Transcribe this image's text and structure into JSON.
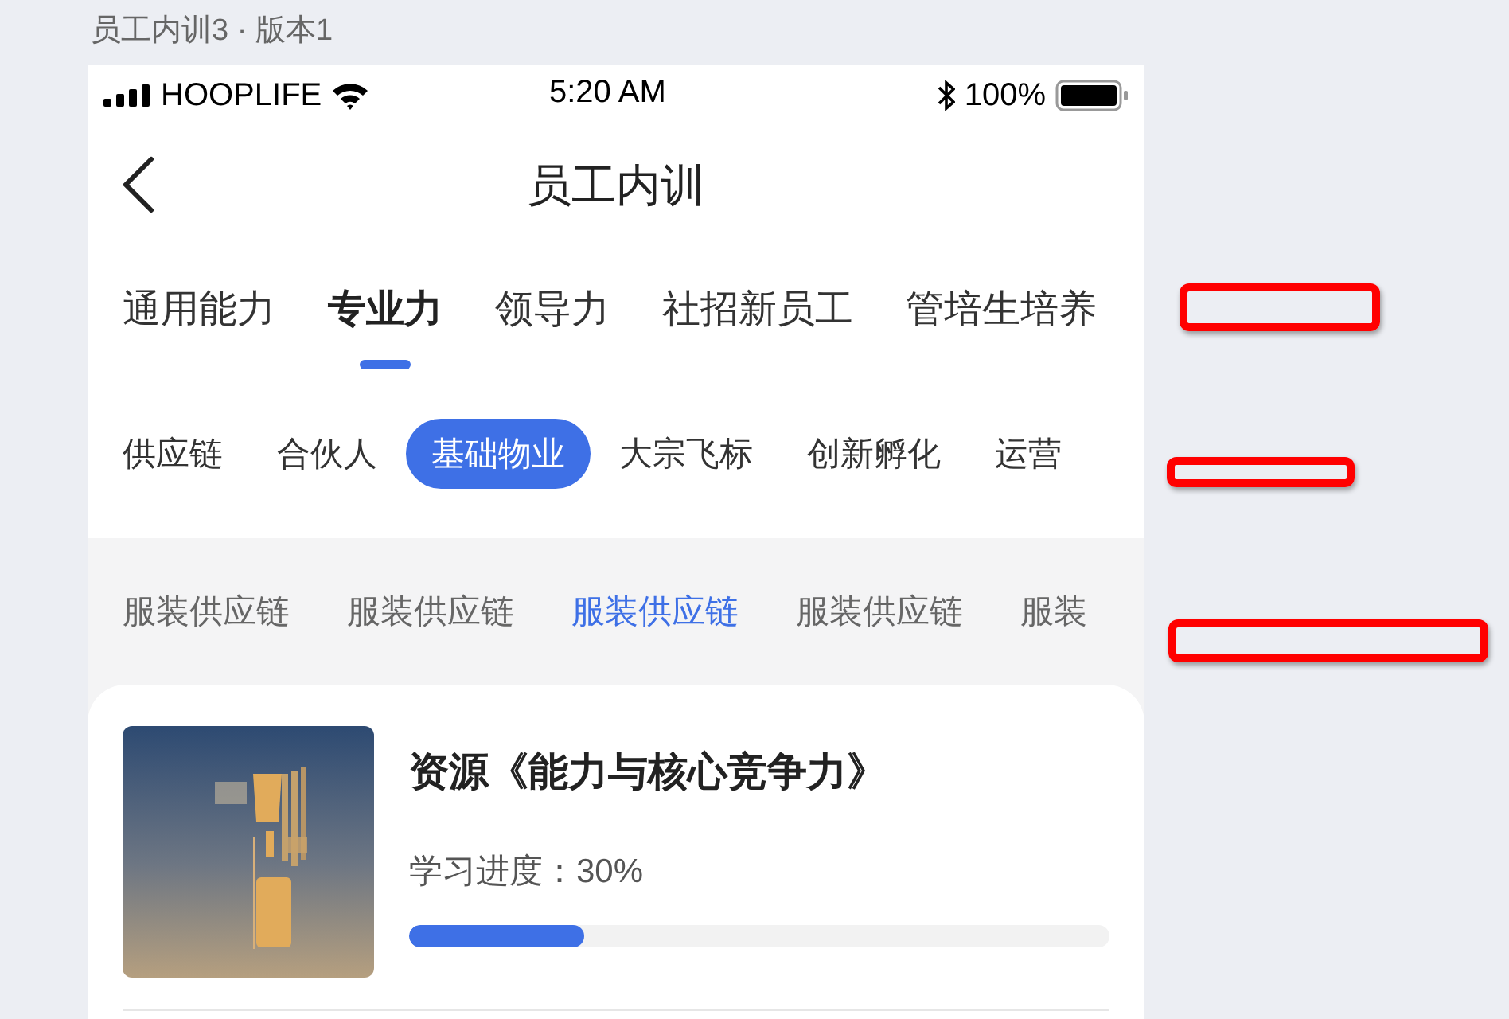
{
  "caption": "员工内训3 · 版本1",
  "status_bar": {
    "carrier": "HOOPLIFE",
    "time": "5:20 AM",
    "battery": "100%"
  },
  "nav": {
    "title": "员工内训"
  },
  "tabs": [
    {
      "label": "通用能力",
      "selected": false
    },
    {
      "label": "专业力",
      "selected": true
    },
    {
      "label": "领导力",
      "selected": false
    },
    {
      "label": "社招新员工",
      "selected": false
    },
    {
      "label": "管培生培养",
      "selected": false
    }
  ],
  "categories": [
    {
      "label": "供应链",
      "selected": false
    },
    {
      "label": "合伙人",
      "selected": false
    },
    {
      "label": "基础物业",
      "selected": true
    },
    {
      "label": "大宗飞标",
      "selected": false
    },
    {
      "label": "创新孵化",
      "selected": false
    },
    {
      "label": "运营",
      "selected": false
    }
  ],
  "subcategories": [
    {
      "label": "服装供应链",
      "selected": false
    },
    {
      "label": "服装供应链",
      "selected": false
    },
    {
      "label": "服装供应链",
      "selected": true
    },
    {
      "label": "服装供应链",
      "selected": false
    },
    {
      "label": "服装",
      "selected": false
    }
  ],
  "courses": [
    {
      "title": "资源《能力与核心竞争力》",
      "progress_label": "学习进度：30%",
      "level": 0.25
    }
  ]
}
